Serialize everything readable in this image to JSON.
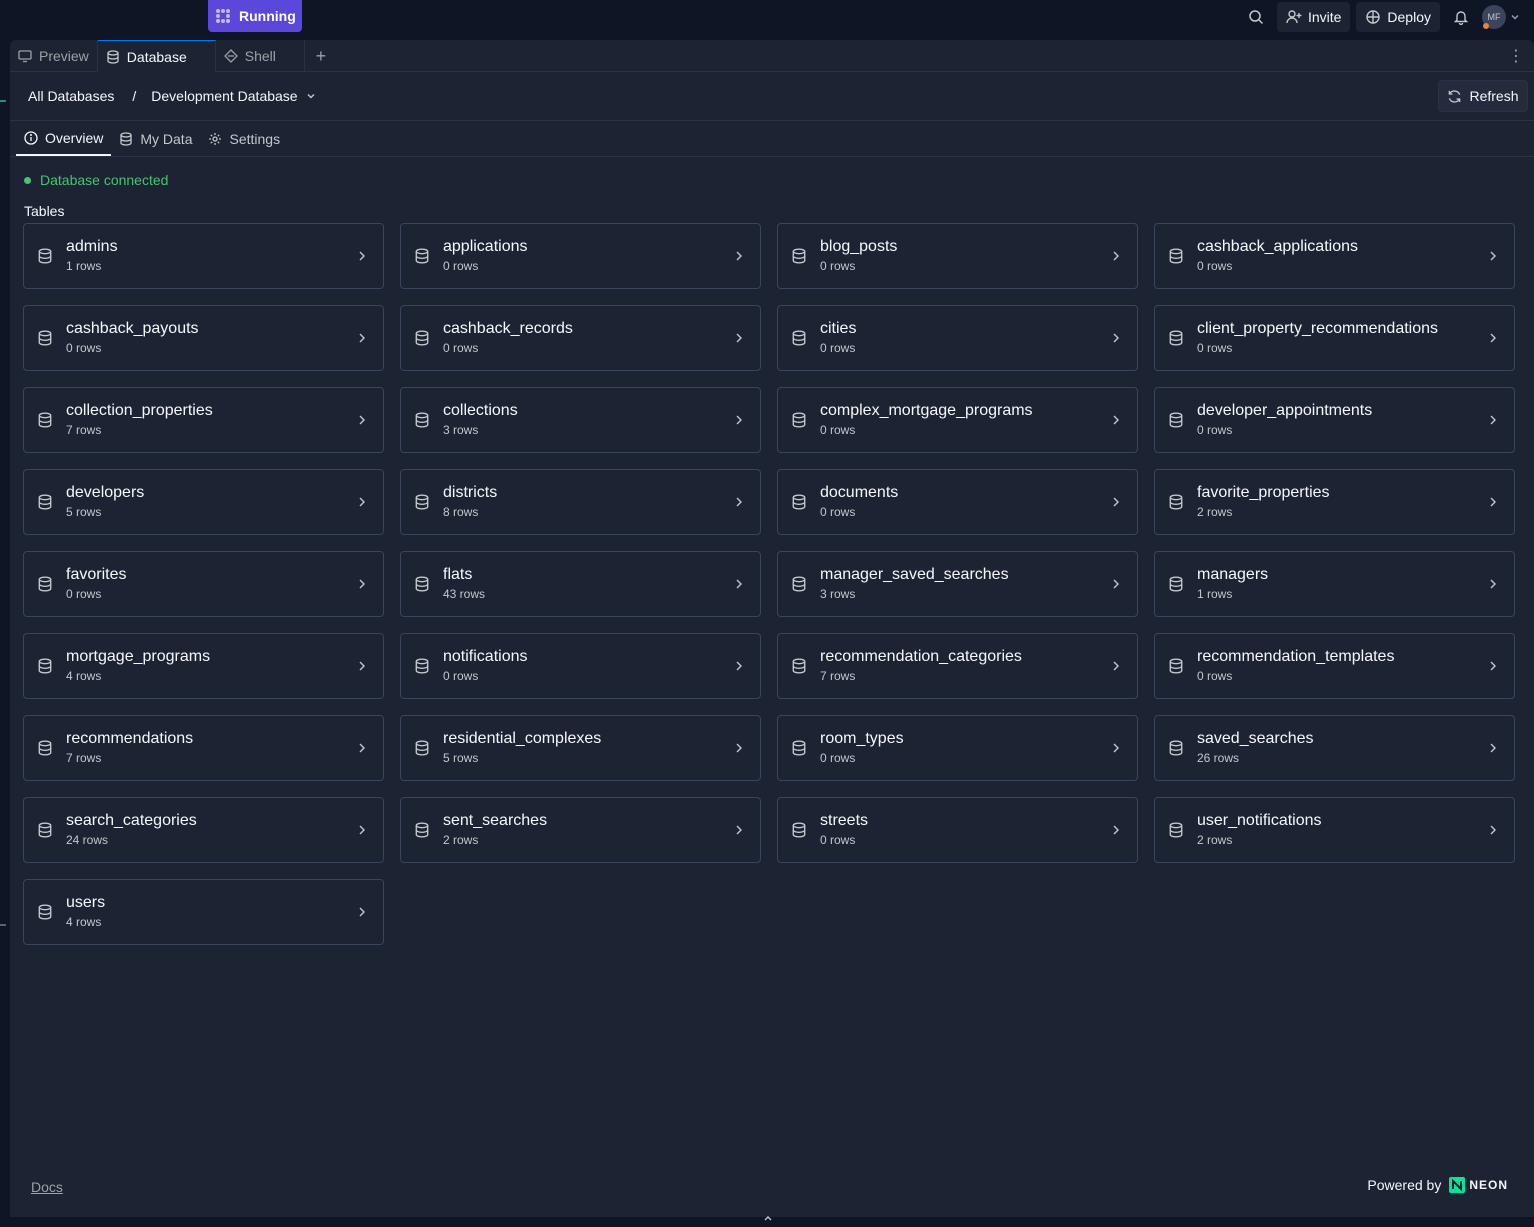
{
  "topbar": {
    "run_label": "Running",
    "invite_label": "Invite",
    "deploy_label": "Deploy",
    "avatar_initials": "MF"
  },
  "tabs": [
    {
      "label": "Preview",
      "icon": "monitor-icon"
    },
    {
      "label": "Database",
      "icon": "database-icon",
      "active": true
    },
    {
      "label": "Shell",
      "icon": "shell-icon"
    }
  ],
  "breadcrumb": {
    "root": "All Databases",
    "separator": "/",
    "current": "Development Database"
  },
  "refresh_label": "Refresh",
  "subtabs": [
    {
      "label": "Overview",
      "icon": "info-icon",
      "active": true
    },
    {
      "label": "My Data",
      "icon": "database-icon"
    },
    {
      "label": "Settings",
      "icon": "gear-icon"
    }
  ],
  "status_text": "Database connected",
  "tables_heading": "Tables",
  "tables": [
    {
      "name": "admins",
      "rows": "1 rows"
    },
    {
      "name": "applications",
      "rows": "0 rows"
    },
    {
      "name": "blog_posts",
      "rows": "0 rows"
    },
    {
      "name": "cashback_applications",
      "rows": "0 rows"
    },
    {
      "name": "cashback_payouts",
      "rows": "0 rows"
    },
    {
      "name": "cashback_records",
      "rows": "0 rows"
    },
    {
      "name": "cities",
      "rows": "0 rows"
    },
    {
      "name": "client_property_recommendations",
      "rows": "0 rows"
    },
    {
      "name": "collection_properties",
      "rows": "7 rows"
    },
    {
      "name": "collections",
      "rows": "3 rows"
    },
    {
      "name": "complex_mortgage_programs",
      "rows": "0 rows"
    },
    {
      "name": "developer_appointments",
      "rows": "0 rows"
    },
    {
      "name": "developers",
      "rows": "5 rows"
    },
    {
      "name": "districts",
      "rows": "8 rows"
    },
    {
      "name": "documents",
      "rows": "0 rows"
    },
    {
      "name": "favorite_properties",
      "rows": "2 rows"
    },
    {
      "name": "favorites",
      "rows": "0 rows"
    },
    {
      "name": "flats",
      "rows": "43 rows"
    },
    {
      "name": "manager_saved_searches",
      "rows": "3 rows"
    },
    {
      "name": "managers",
      "rows": "1 rows"
    },
    {
      "name": "mortgage_programs",
      "rows": "4 rows"
    },
    {
      "name": "notifications",
      "rows": "0 rows"
    },
    {
      "name": "recommendation_categories",
      "rows": "7 rows"
    },
    {
      "name": "recommendation_templates",
      "rows": "0 rows"
    },
    {
      "name": "recommendations",
      "rows": "7 rows"
    },
    {
      "name": "residential_complexes",
      "rows": "5 rows"
    },
    {
      "name": "room_types",
      "rows": "0 rows"
    },
    {
      "name": "saved_searches",
      "rows": "26 rows"
    },
    {
      "name": "search_categories",
      "rows": "24 rows"
    },
    {
      "name": "sent_searches",
      "rows": "2 rows"
    },
    {
      "name": "streets",
      "rows": "0 rows"
    },
    {
      "name": "user_notifications",
      "rows": "2 rows"
    },
    {
      "name": "users",
      "rows": "4 rows"
    }
  ],
  "footer": {
    "docs_label": "Docs",
    "powered_by": "Powered by",
    "brand": "NEON"
  },
  "colors": {
    "accent": "#5b47d9",
    "connected": "#46c56a",
    "neon": "#00e599"
  }
}
